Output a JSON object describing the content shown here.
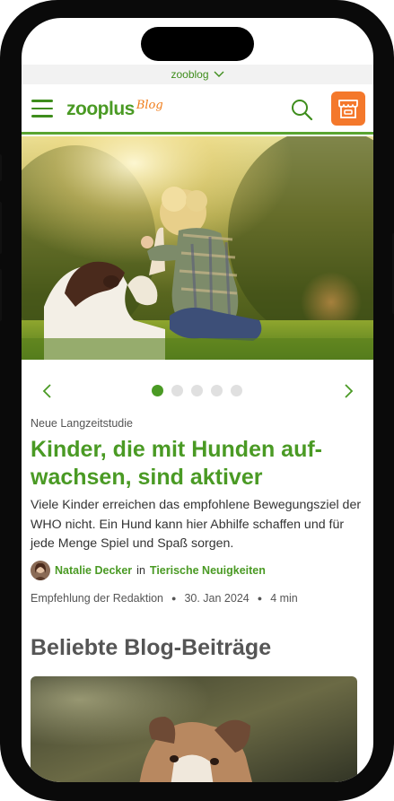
{
  "topbar": {
    "label": "zooblog"
  },
  "header": {
    "logo_text": "zooplus",
    "logo_sub": "Blog"
  },
  "icons": {
    "menu": "hamburger-menu-icon",
    "search": "search-icon",
    "shop": "shop-icon",
    "prev": "chevron-left-icon",
    "next": "chevron-right-icon"
  },
  "colors": {
    "brand_green": "#4a9a24",
    "accent_orange": "#f4782b"
  },
  "carousel": {
    "slide_count": 5,
    "active_slide": 1
  },
  "article": {
    "kicker": "Neue Langzeitstudie",
    "title": "Kinder, die mit Hunden auf-wachsen, sind aktiver",
    "teaser": "Viele Kinder erreichen das empfohlene Bewegungsziel der WHO nicht. Ein Hund kann hier Abhilfe schaffen und für jede Menge Spiel und Spaß sorgen.",
    "author": "Natalie Decker",
    "in_word": "in",
    "category": "Tierische Neuigkeiten",
    "meta_label": "Empfehlung der Redaktion",
    "date": "30. Jan 2024",
    "read_time": "4 min"
  },
  "popular": {
    "title": "Beliebte Blog-Beiträge"
  }
}
